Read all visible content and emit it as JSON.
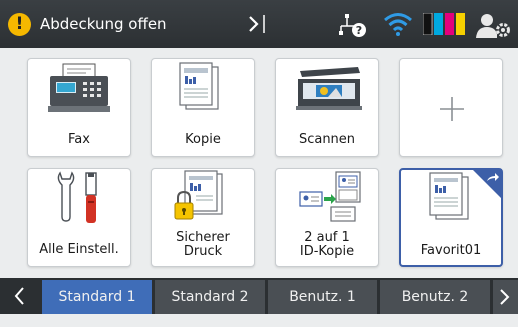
{
  "status_bar": {
    "message": "Abdeckung offen",
    "warning_glyph": "!",
    "warning_color": "#f5b800",
    "ink_colors": [
      "#111111",
      "#00a9e0",
      "#e4007c",
      "#f6d000"
    ]
  },
  "tiles": [
    {
      "label": "Fax",
      "icon": "fax-icon"
    },
    {
      "label": "Kopie",
      "icon": "copy-icon"
    },
    {
      "label": "Scannen",
      "icon": "scanner-icon"
    },
    {
      "label": "",
      "icon": "plus-icon"
    },
    {
      "label": "Alle Einstell.",
      "icon": "tools-icon"
    },
    {
      "label_line1": "Sicherer",
      "label_line2": "Druck",
      "icon": "secure-print-icon"
    },
    {
      "label_line1": "2 auf 1",
      "label_line2": "ID-Kopie",
      "icon": "id-copy-icon"
    },
    {
      "label": "Favorit01",
      "icon": "document-icon"
    }
  ],
  "tabs": [
    {
      "label": "Standard 1",
      "active": true
    },
    {
      "label": "Standard 2",
      "active": false
    },
    {
      "label": "Benutz. 1",
      "active": false
    },
    {
      "label": "Benutz. 2",
      "active": false
    }
  ],
  "accent_color": "#3f6db8"
}
